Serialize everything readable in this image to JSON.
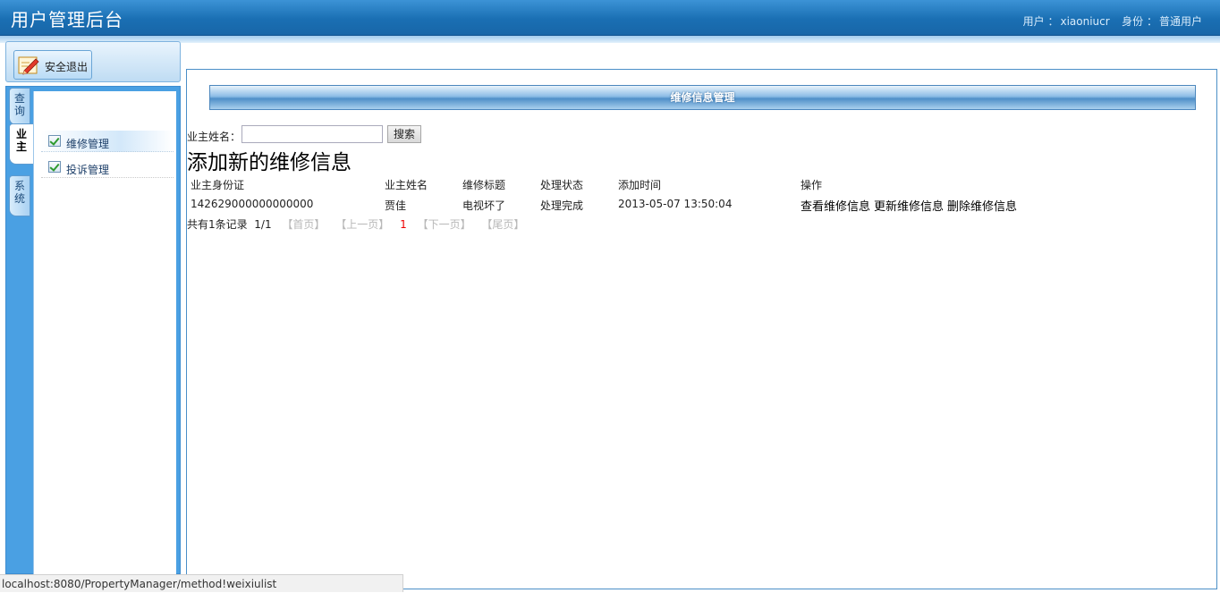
{
  "header": {
    "title": "用户管理后台",
    "user_label": "用户 ：",
    "username": "xiaoniucr",
    "role_label": "身份 ：",
    "role": "普通用户"
  },
  "sidebar": {
    "logout_label": "安全退出",
    "tabs": [
      {
        "label": "查询"
      },
      {
        "label": "业主"
      },
      {
        "label": "系统"
      }
    ],
    "menu": [
      {
        "label": "维修管理"
      },
      {
        "label": "投诉管理"
      }
    ]
  },
  "main": {
    "section_title": "维修信息管理",
    "search": {
      "label": "业主姓名：",
      "value": "",
      "button": "搜索"
    },
    "add_link": "添加新的维修信息",
    "table": {
      "headers": [
        "业主身份证",
        "业主姓名",
        "维修标题",
        "处理状态",
        "添加时间",
        "操作"
      ],
      "rows": [
        {
          "id_card": "142629000000000000",
          "name": "贾佳",
          "title": "电视坏了",
          "status": "处理完成",
          "time": "2013-05-07 13:50:04",
          "ops": [
            "查看维修信息",
            "更新维修信息",
            "删除维修信息"
          ]
        }
      ]
    },
    "pager": {
      "summary": "共有1条记录",
      "page": "1/1",
      "first": "【首页】",
      "prev": "【上一页】",
      "current": "1",
      "next": "【下一页】",
      "last": "【尾页】"
    }
  },
  "statusbar": {
    "url": "localhost:8080/PropertyManager/method!weixiulist"
  },
  "colors": {
    "header": "#1a6fb3",
    "nav": "#4aa0e3",
    "accent": "#4f8fc8"
  },
  "icons": {
    "logout": "pencil-edit-icon",
    "menu": "checkbox-icon"
  }
}
